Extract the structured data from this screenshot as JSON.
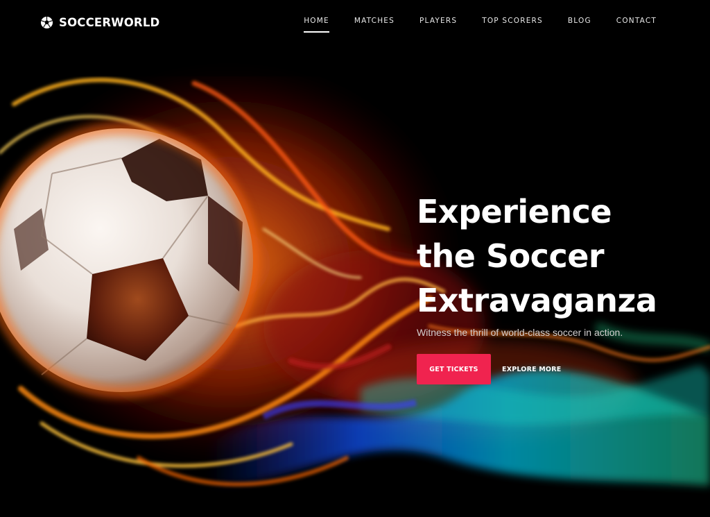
{
  "brand": {
    "name": "SOCCERWORLD",
    "icon": "soccer-ball-icon"
  },
  "nav": {
    "items": [
      {
        "label": "HOME",
        "active": true
      },
      {
        "label": "MATCHES",
        "active": false
      },
      {
        "label": "PLAYERS",
        "active": false
      },
      {
        "label": "TOP SCORERS",
        "active": false
      },
      {
        "label": "BLOG",
        "active": false
      },
      {
        "label": "CONTACT",
        "active": false
      }
    ]
  },
  "hero": {
    "title_lines": [
      "Experience",
      "the Soccer",
      "Extravaganza"
    ],
    "subtitle": "Witness the thrill of world-class soccer in action.",
    "primary_button": "GET TICKETS",
    "secondary_button": "EXPLORE MORE",
    "image": "flaming-soccer-ball"
  },
  "colors": {
    "background": "#000000",
    "accent": "#f0234f",
    "text": "#ffffff",
    "subtitle": "#d4cfcf"
  }
}
